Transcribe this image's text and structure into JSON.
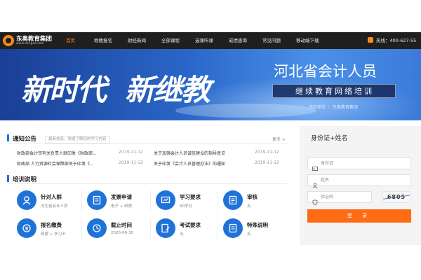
{
  "logo": {
    "name": "东奥教育集团",
    "url": "www.dongao.com"
  },
  "nav": [
    "首页",
    "继教报名",
    "财经新闻",
    "全部课程",
    "选课听课",
    "成绩查询",
    "常见问题",
    "移动端下载"
  ],
  "phone": "热线：400-627-55",
  "banner": {
    "slogan_left": "新时代",
    "slogan_right": "新继教",
    "title": "河北省会计人员",
    "subtitle": "继续教育网络培训",
    "partner": "协办单位 ｜ 东奥教育集团"
  },
  "notice": {
    "title": "通知公告",
    "hint": "最新信息，快速了解您的学习内容",
    "more": "更多 >",
    "items": [
      {
        "text": "财政部会计司有关负责人就印发《财政部...",
        "date": "2019-11-12"
      },
      {
        "text": "关于加强会计人员诚信建设的指导意见",
        "date": "2019-11-12"
      },
      {
        "text": "财政部 人力资源社会保障部关于印发《...",
        "date": "2019-11-12"
      },
      {
        "text": "关于印发《会计人员管理办法》的通知",
        "date": "2019-11-12"
      }
    ]
  },
  "training": {
    "title": "培训说明",
    "features": [
      {
        "label": "针对人群",
        "desc": "河北省会计人员",
        "icon": "target-group-icon"
      },
      {
        "label": "发票申请",
        "desc": "电子 + 纸质",
        "icon": "invoice-icon"
      },
      {
        "label": "学习要求",
        "desc": "90学分",
        "icon": "study-requirement-icon"
      },
      {
        "label": "审核",
        "desc": "无",
        "icon": "audit-icon"
      },
      {
        "label": "报名缴费",
        "desc": "网银 + 学习卡",
        "icon": "payment-icon"
      },
      {
        "label": "截止时间",
        "desc": "2020-06-30",
        "icon": "deadline-clock-icon"
      },
      {
        "label": "考试要求",
        "desc": "无",
        "icon": "exam-icon"
      },
      {
        "label": "特殊说明",
        "desc": "无",
        "icon": "special-note-icon"
      }
    ]
  },
  "login": {
    "title": "身份证+姓名",
    "id_placeholder": "身份证",
    "name_placeholder": "姓名",
    "captcha_placeholder": "验证码",
    "captcha_code": "6805",
    "button": "登 录"
  },
  "colors": {
    "accent_blue": "#1f73d8",
    "accent_orange": "#ff6a14",
    "topbar": "#1f1f1f"
  }
}
